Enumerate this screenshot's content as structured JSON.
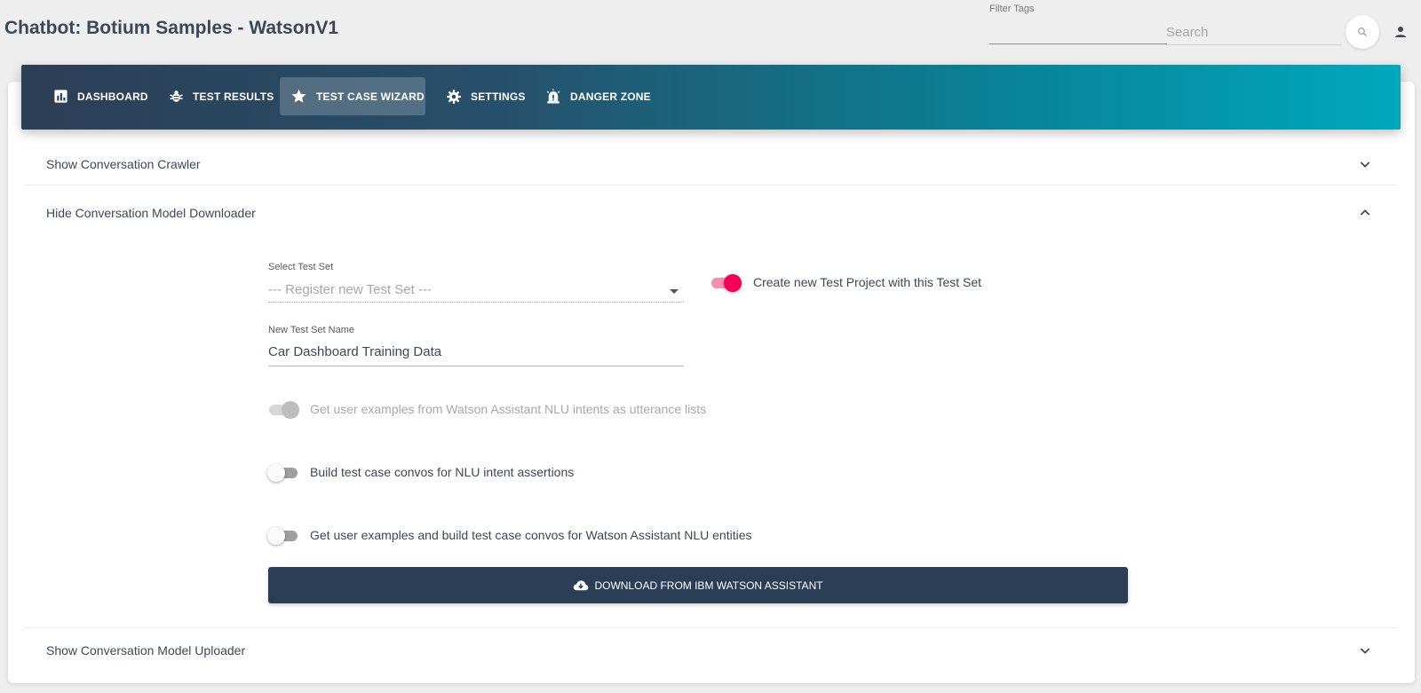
{
  "header": {
    "title": "Chatbot: Botium Samples - WatsonV1",
    "filter_tags_label": "Filter Tags",
    "search_placeholder": "Search"
  },
  "nav": {
    "items": [
      {
        "label": "DASHBOARD",
        "icon": "bar-chart-icon",
        "active": false
      },
      {
        "label": "TEST RESULTS",
        "icon": "bug-icon",
        "active": false
      },
      {
        "label": "TEST CASE WIZARD",
        "icon": "star-icon",
        "active": true
      },
      {
        "label": "SETTINGS",
        "icon": "gear-icon",
        "active": false
      },
      {
        "label": "DANGER ZONE",
        "icon": "alarm-icon",
        "active": false
      }
    ]
  },
  "panels": {
    "crawler": {
      "label": "Show Conversation Crawler",
      "expanded": false
    },
    "downloader": {
      "label": "Hide Conversation Model Downloader",
      "expanded": true
    },
    "uploader": {
      "label": "Show Conversation Model Uploader",
      "expanded": false
    }
  },
  "downloader_form": {
    "select_test_set_label": "Select Test Set",
    "select_test_set_value": "--- Register new Test Set ---",
    "create_project_label": "Create new Test Project with this Test Set",
    "create_project_on": true,
    "new_test_set_name_label": "New Test Set Name",
    "new_test_set_name_value": "Car Dashboard Training Data",
    "toggle_intents_label": "Get user examples from Watson Assistant NLU intents as utterance lists",
    "toggle_intents_state": "disabled-on",
    "toggle_convos_label": "Build test case convos for NLU intent assertions",
    "toggle_convos_on": false,
    "toggle_entities_label": "Get user examples and build test case convos for Watson Assistant NLU entities",
    "toggle_entities_on": false,
    "download_button_label": "DOWNLOAD FROM IBM WATSON ASSISTANT"
  },
  "colors": {
    "primary_dark": "#2c3e55",
    "accent": "#f50057",
    "gradient_end": "#00a8bd"
  }
}
